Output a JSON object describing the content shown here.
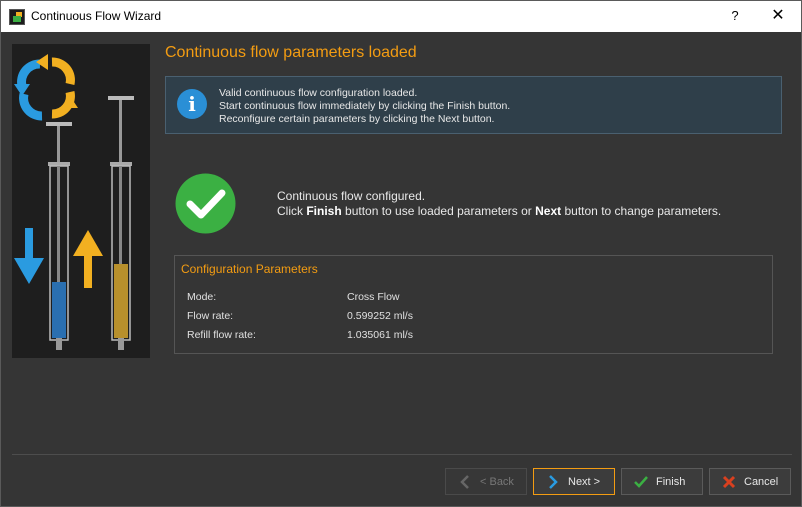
{
  "window": {
    "title": "Continuous Flow Wizard",
    "help_label": "?",
    "close_label": "✕"
  },
  "heading": "Continuous flow parameters loaded",
  "info": {
    "lines": [
      "Valid continuous flow configuration loaded.",
      "Start continuous flow immediately by clicking the Finish button.",
      "Reconfigure certain parameters by clicking the Next button."
    ]
  },
  "status": {
    "line1": "Continuous flow configured.",
    "line2_pre": "Click ",
    "line2_finish": "Finish",
    "line2_mid": " button to use loaded parameters or ",
    "line2_next": "Next",
    "line2_post": " button to change parameters."
  },
  "config": {
    "title": "Configuration Parameters",
    "rows": [
      {
        "key": "Mode:",
        "value": "Cross Flow"
      },
      {
        "key": "Flow rate:",
        "value": "0.599252 ml/s"
      },
      {
        "key": "Refill flow rate:",
        "value": "1.035061 ml/s"
      }
    ]
  },
  "buttons": {
    "back": "< Back",
    "next": "Next >",
    "finish": "Finish",
    "cancel": "Cancel"
  },
  "colors": {
    "accent": "#f39c12",
    "info_blue": "#2a8fd6",
    "check_green": "#3bb043",
    "cancel_red": "#d9401f"
  }
}
